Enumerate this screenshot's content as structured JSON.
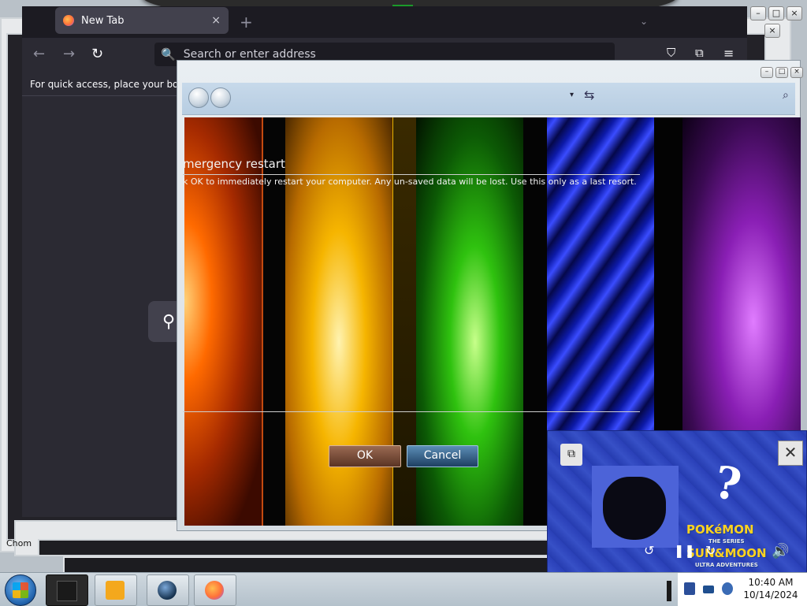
{
  "firefox": {
    "tab_title": "New Tab",
    "tab_close": "×",
    "new_tab": "+",
    "tab_list": "⌄",
    "nav_back": "←",
    "nav_forward": "→",
    "nav_reload": "↻",
    "url_placeholder": "Search or enter address",
    "bookmarks_hint": "For quick access, place your bookm",
    "search_icon": "search-icon"
  },
  "behind_window_label": "Chom",
  "explorer": {
    "dropdown": "▾",
    "refresh": "⇆",
    "search_icon": "⌕"
  },
  "dialog": {
    "title": "mergency restart",
    "message": "k OK to immediately restart your computer.  Any un-saved data will be lost.  Use this only as a last resort.",
    "ok_label": "OK",
    "cancel_label": "Cancel"
  },
  "media_player": {
    "question_mark": "?",
    "logo_top": "POKéMON",
    "logo_series": "THE SERIES",
    "logo_title": "SUN&MOON",
    "logo_sub": "ULTRA ADVENTURES",
    "close": "✕",
    "snapshot": "⧉",
    "replay": "↺",
    "pause": "❚❚",
    "forward": "↻",
    "volume": "🔊"
  },
  "taskbar": {
    "clock_time": "10:40 AM",
    "clock_date": "10/14/2024"
  },
  "colors": {
    "firefox_bg": "#2b2a33",
    "ok_button": "#7a4c38",
    "cancel_button": "#2f5b86",
    "taskbar": "#c4cfd8"
  }
}
